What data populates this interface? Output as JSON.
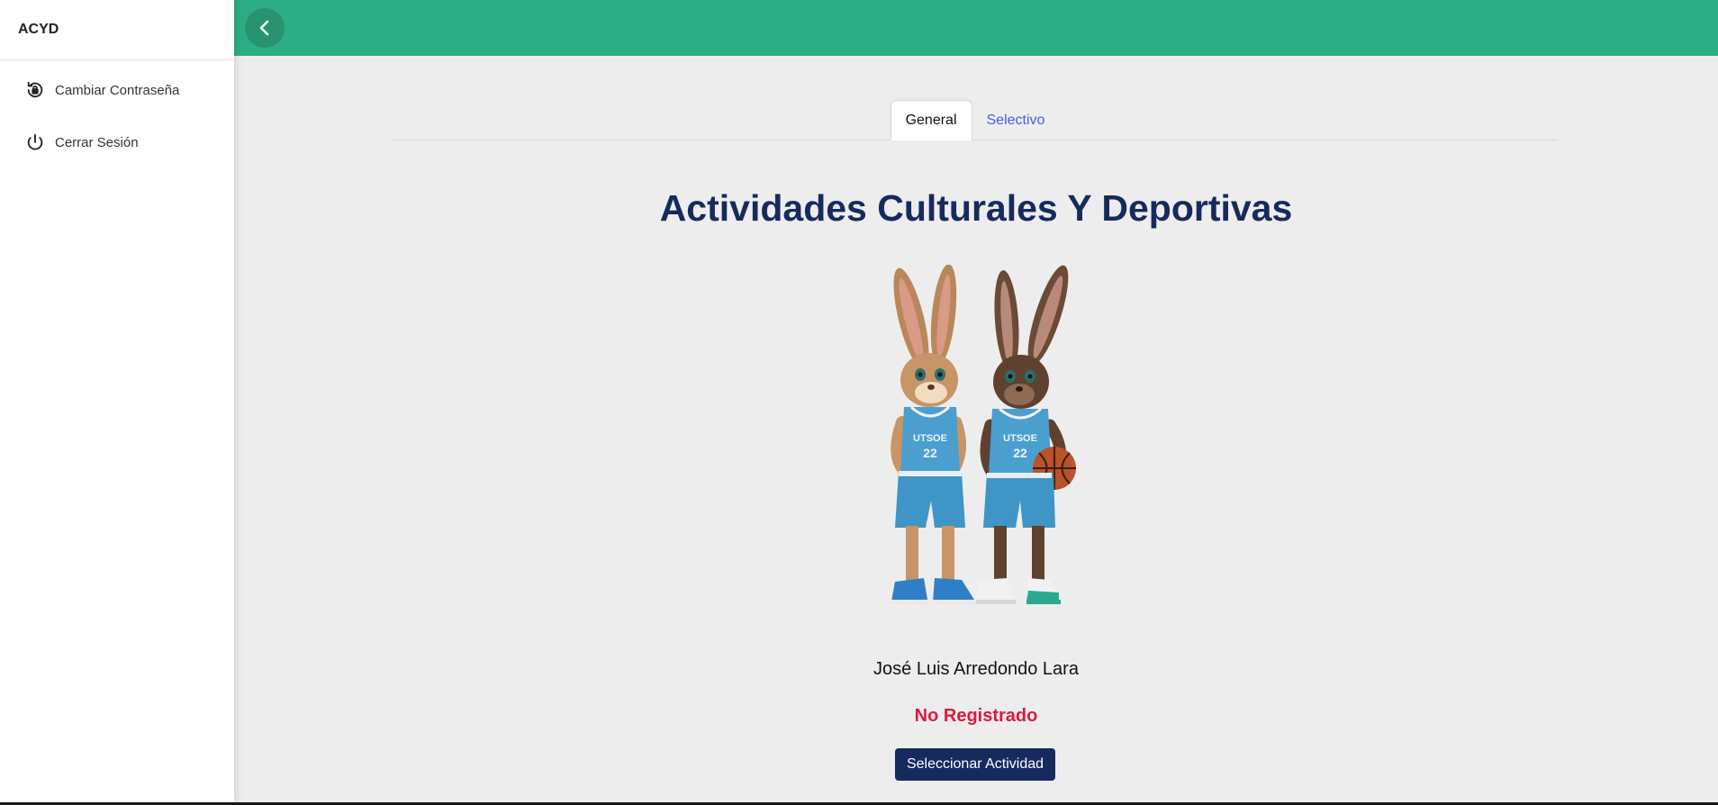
{
  "sidebar": {
    "brand": "ACYD",
    "items": [
      {
        "label": "Cambiar Contraseña",
        "icon": "lock-reset-icon"
      },
      {
        "label": "Cerrar Sesión",
        "icon": "power-icon"
      }
    ]
  },
  "topbar": {
    "color": "#2dad85",
    "back_icon": "chevron-left-icon"
  },
  "tabs": [
    {
      "label": "General",
      "active": true
    },
    {
      "label": "Selectivo",
      "active": false
    }
  ],
  "main": {
    "title": "Actividades Culturales Y Deportivas",
    "mascot_icon": "rabbit-basketball-mascots-image",
    "user_name": "José Luis Arredondo Lara",
    "status": "No Registrado",
    "action_label": "Seleccionar Actividad"
  },
  "colors": {
    "accent": "#2dad85",
    "title": "#162a5e",
    "status": "#e0183f",
    "link": "#4a5de0",
    "button": "#162a5e"
  }
}
